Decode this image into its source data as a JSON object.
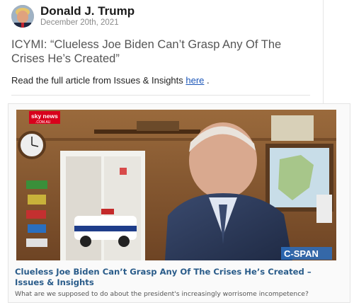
{
  "post": {
    "author_name": "Donald J. Trump",
    "date": "December 20th, 2021",
    "title": "ICYMI: “Clueless Joe Biden Can’t Grasp Any Of The Crises He’s Created”",
    "body_prefix": "Read the full article from Issues & Insights ",
    "body_link": "here",
    "body_suffix": " ."
  },
  "card": {
    "title": "Clueless Joe Biden Can’t Grasp Any Of The Crises He’s Created – Issues & Insights",
    "description": "What are we supposed to do about the president's increasingly worrisome incompetence?",
    "image": {
      "broadcaster_logo": "sky news",
      "broadcaster_sub": ".COM.AU",
      "watermark": "C-SPAN"
    }
  },
  "colors": {
    "link": "#1a55b8",
    "card_title": "#2a5c8a",
    "sky_red": "#d8001c",
    "cspan_blue": "#2a6fbf"
  }
}
